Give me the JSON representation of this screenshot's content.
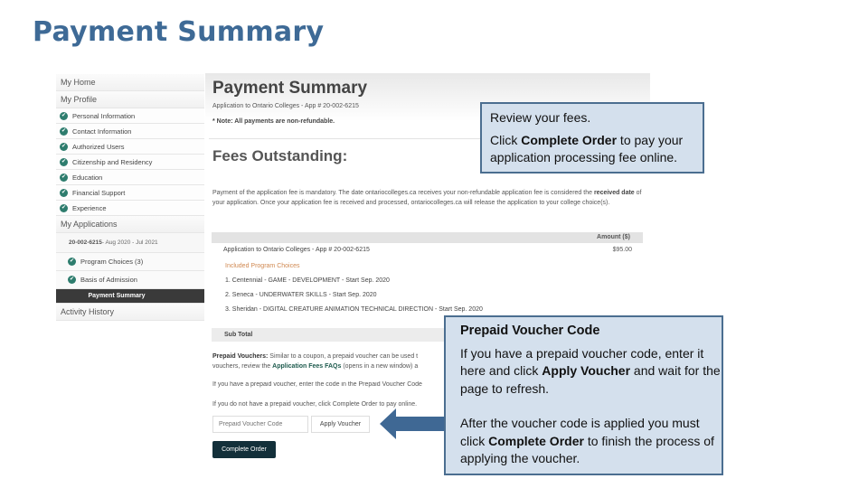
{
  "slide_title": "Payment Summary",
  "sidebar": {
    "my_home": "My Home",
    "my_profile": "My Profile",
    "profile_items": [
      {
        "label": "Personal Information",
        "icon": "check-circle-icon"
      },
      {
        "label": "Contact Information",
        "icon": "check-circle-icon"
      },
      {
        "label": "Authorized Users",
        "icon": "check-circle-icon"
      },
      {
        "label": "Citizenship and Residency",
        "icon": "check-circle-icon"
      },
      {
        "label": "Education",
        "icon": "check-circle-icon"
      },
      {
        "label": "Financial Support",
        "icon": "check-circle-icon"
      },
      {
        "label": "Experience",
        "icon": "check-circle-icon"
      }
    ],
    "my_applications": "My Applications",
    "app_number": "20-002-6215",
    "app_dates": " - Aug 2020 - Jul 2021",
    "app_items": [
      {
        "label": "Program Choices (3)",
        "icon": "check-circle-icon"
      },
      {
        "label": "Basis of Admission",
        "icon": "check-circle-icon"
      }
    ],
    "active_item": "Payment Summary",
    "activity_history": "Activity History"
  },
  "main": {
    "title": "Payment Summary",
    "app_line": "Application to Ontario Colleges - App # 20-002-6215",
    "note": "* Note: All payments are non-refundable.",
    "fees_title": "Fees Outstanding:",
    "paragraph_1": "Payment of the application fee is mandatory. The date ontariocolleges.ca receives your non-refundable application fee is considered the ",
    "paragraph_bold": "received date",
    "paragraph_2": " of your application. Once your application fee is received and processed, ontariocolleges.ca will release the application to your college choice(s).",
    "table": {
      "amount_header": "Amount ($)",
      "app_row_label": "Application to Ontario Colleges - App # 20-002-6215",
      "app_row_amount": "$95.00",
      "included_label": "Included Program Choices",
      "programs": [
        "1. Centennial - GAME - DEVELOPMENT - Start Sep. 2020",
        "2. Seneca - UNDERWATER SKILLS - Start Sep. 2020",
        "3. Sheridan - DIGITAL CREATURE ANIMATION TECHNICAL DIRECTION - Start Sep. 2020"
      ],
      "sub_total_label": "Sub Total"
    },
    "prepaid": {
      "label": "Prepaid Vouchers:",
      "text_1": " Similar to a coupon, a prepaid voucher can be used t",
      "text_2a": "vouchers, review the ",
      "faq_link": "Application Fees FAQs",
      "text_2b": " (opens in a new window) a",
      "line_3": "If you have a prepaid voucher, enter the code in the Prepaid Voucher Code",
      "line_4": "If you do not have a prepaid voucher, click Complete Order to pay online."
    },
    "voucher_placeholder": "Prepaid Voucher Code",
    "apply_voucher_label": "Apply Voucher",
    "complete_order_label": "Complete Order"
  },
  "callout_1": {
    "line_1": "Review your fees.",
    "line_2a": "Click ",
    "line_2b": "Complete Order",
    "line_2c": " to pay your  application processing fee online."
  },
  "callout_2": {
    "title": "Prepaid Voucher Code",
    "p1a": "If you have a prepaid voucher code,  enter it here and click ",
    "p1b": "Apply Voucher",
    "p1c": "  and wait for the page to refresh.",
    "p2a": "After the voucher code is applied you  must click ",
    "p2b": "Complete Order",
    "p2c": " to finish  the process of applying the voucher."
  },
  "colors": {
    "title_blue": "#3e6a96",
    "callout_fill": "#d4e0ed",
    "callout_border": "#4b6e90",
    "check_green": "#2e7d6e",
    "active_nav": "#3a3a3a",
    "complete_btn": "#13303a",
    "included_orange": "#d08850"
  }
}
